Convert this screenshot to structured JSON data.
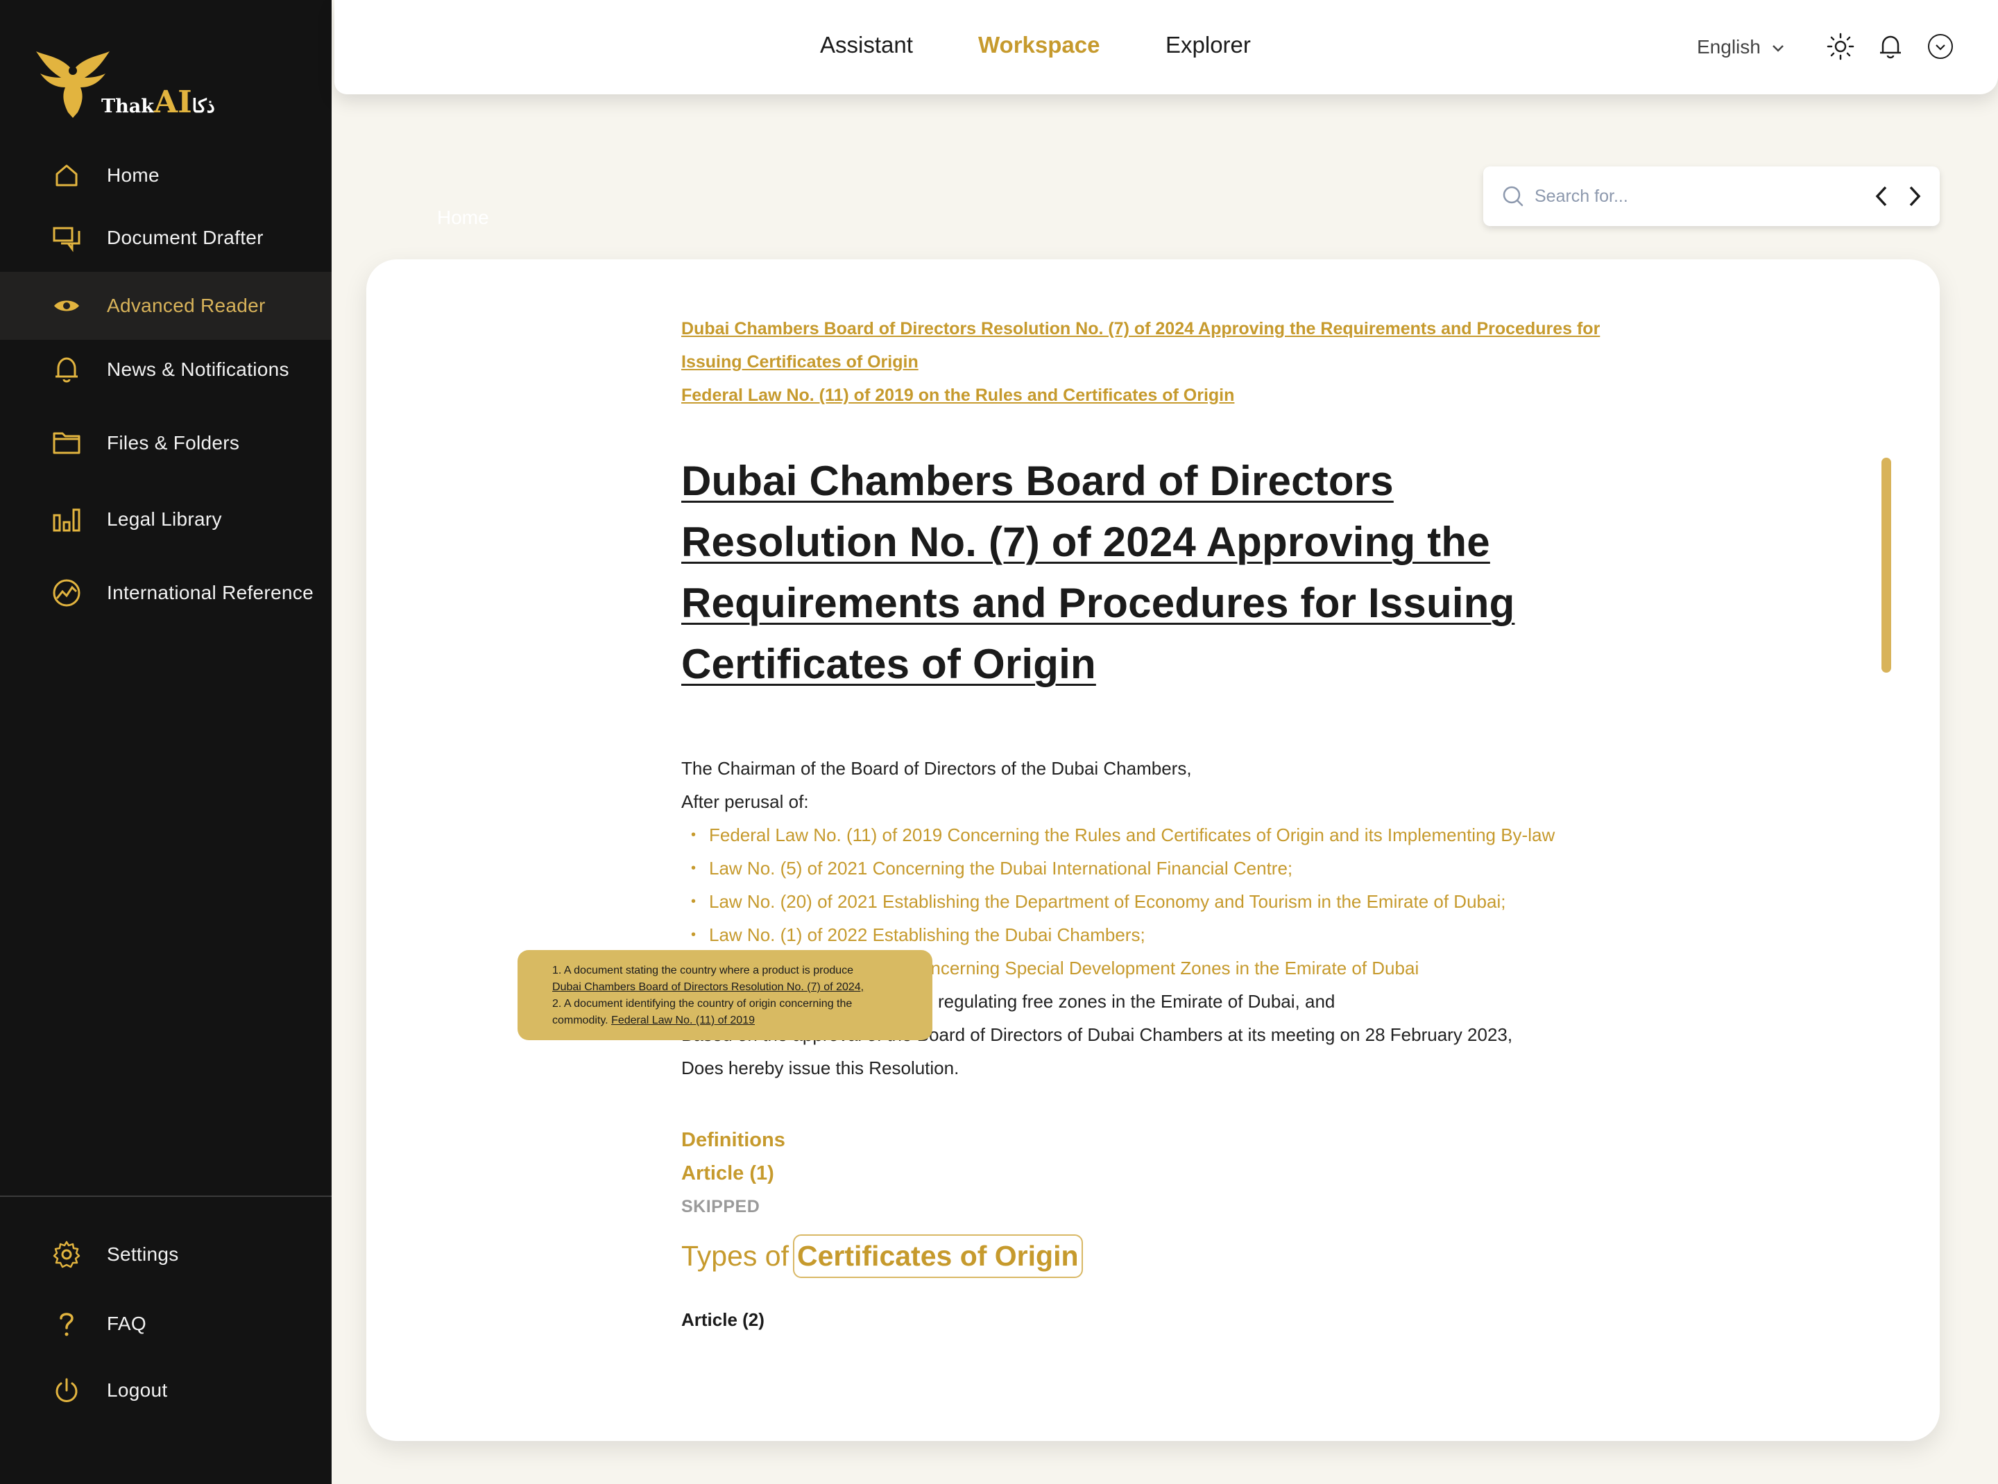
{
  "brand": {
    "logo_prefix": "Thak",
    "logo_ai": "AI",
    "logo_arabic": "ذكا"
  },
  "sidebar": {
    "items": [
      {
        "label": "Home",
        "icon": "home-icon"
      },
      {
        "label": "Document Drafter",
        "icon": "chat-icon"
      },
      {
        "label": "Advanced Reader",
        "icon": "eye-icon",
        "active": true
      },
      {
        "label": "News & Notifications",
        "icon": "bell-icon"
      },
      {
        "label": "Files & Folders",
        "icon": "folder-icon"
      },
      {
        "label": "Legal Library",
        "icon": "library-icon"
      },
      {
        "label": "International Reference",
        "icon": "globe-icon"
      }
    ],
    "bottom_items": [
      {
        "label": "Settings",
        "icon": "gear-icon"
      },
      {
        "label": "FAQ",
        "icon": "question-icon"
      },
      {
        "label": "Logout",
        "icon": "power-icon"
      }
    ]
  },
  "topbar": {
    "tabs": [
      "Assistant",
      "Workspace",
      "Explorer"
    ],
    "active_tab": "Workspace",
    "language": "English"
  },
  "breadcrumb": "Home",
  "search": {
    "placeholder": "Search for..."
  },
  "document": {
    "ref_links": [
      "Dubai Chambers Board of Directors Resolution No. (7) of 2024 Approving the Requirements and Procedures for Issuing Certificates of Origin",
      "Federal Law No. (11) of 2019 on the Rules and Certificates of Origin"
    ],
    "title": "Dubai Chambers Board of Directors Resolution No. (7) of 2024 Approving the Requirements and Procedures for Issuing Certificates of Origin",
    "intro_1": "The Chairman of the Board of Directors of the Dubai Chambers,",
    "intro_2": "After perusal of:",
    "perusal": [
      "Federal Law No. (11) of 2019 Concerning the Rules and Certificates of Origin and its Implementing By-law",
      "Law No. (5) of 2021 Concerning the Dubai International Financial Centre;",
      "Law No. (20) of 2021 Establishing the Department of Economy and Tourism in the Emirate of Dubai;",
      "Law No. (1) of 2022 Establishing the Dubai Chambers;",
      "Decree No. (22) of 2009 Concerning Special Development Zones in the Emirate of Dubai"
    ],
    "after_1": "The legislation establishing and regulating free zones in the Emirate of Dubai, and",
    "after_2": "Based on the approval of the Board of Directors of Dubai Chambers at its meeting on 28 February 2023,",
    "after_3": "Does hereby issue this Resolution.",
    "definitions": "Definitions",
    "article1": "Article (1)",
    "skipped": "SKIPPED",
    "types_prefix": "Types of",
    "types_highlight": "Certificates of Origin",
    "article2": "Article (2)"
  },
  "tooltip": {
    "line1": "1. A document stating the country where a product is produce",
    "line2": "Dubai Chambers Board of Directors Resolution No. (7) of 2024,",
    "line3": "2. A document identifying the country of origin concerning the",
    "line4_prefix": "commodity.",
    "line4_link": "Federal Law No. (11) of 2019"
  },
  "colors": {
    "accent": "#c69a2d",
    "sidebar_bg": "#131313",
    "page_bg": "#f7f5ee"
  }
}
